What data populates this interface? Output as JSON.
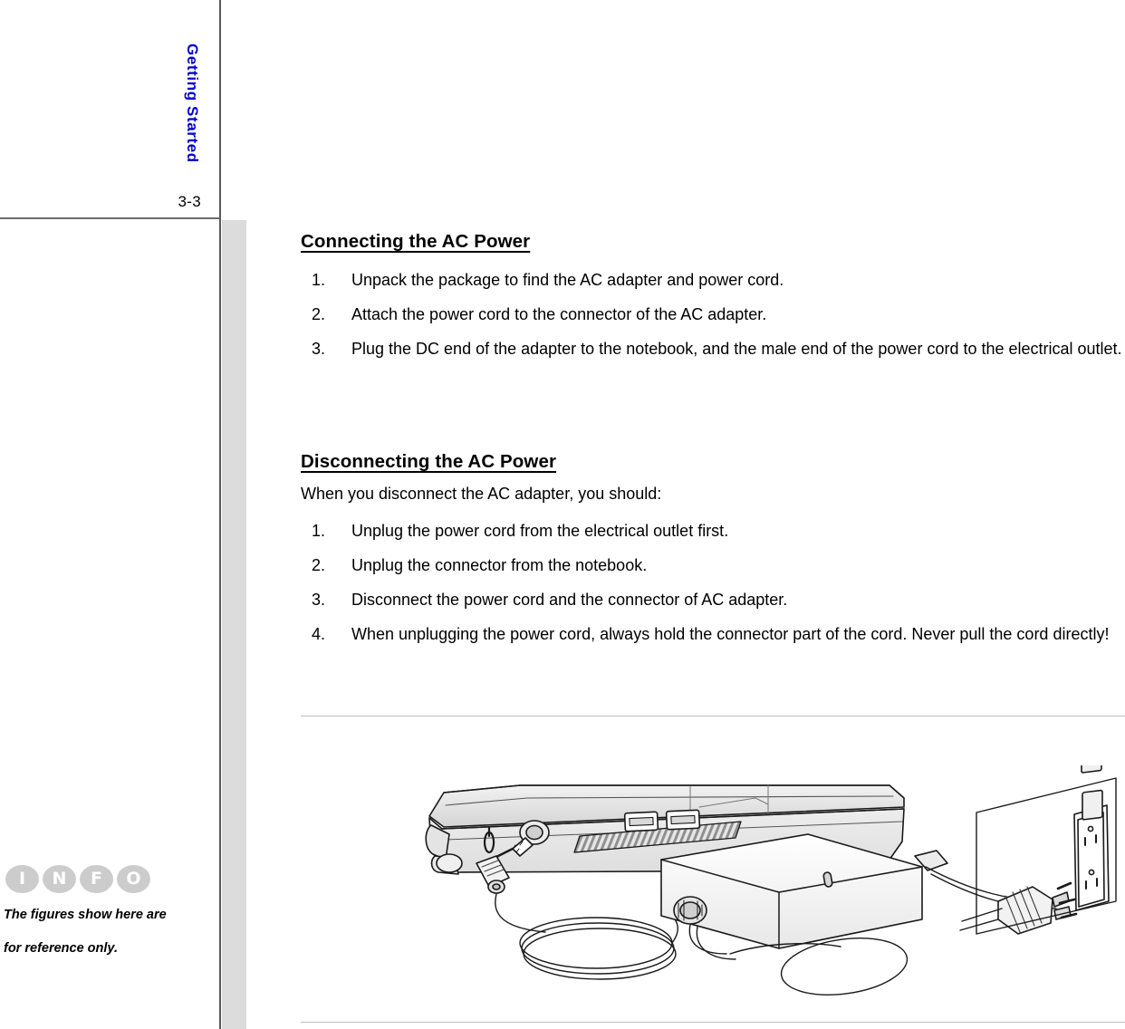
{
  "page": {
    "number": "3-3",
    "chapter_label": "Getting Started"
  },
  "sections": [
    {
      "heading": "Connecting the AC Power",
      "steps": [
        "Unpack the package to find the AC adapter and power cord.",
        "Attach the power cord to the connector of the AC adapter.",
        "Plug the DC end of the adapter to the notebook, and the male end of the power cord to the electrical outlet."
      ]
    },
    {
      "heading": "Disconnecting the AC Power",
      "intro": "When you disconnect the AC adapter, you should:",
      "steps": [
        "Unplug the power cord from the electrical outlet first.",
        "Unplug the connector from the notebook.",
        "Disconnect the power cord and the connector of AC adapter.",
        "When unplugging the power cord, always hold the connector part of the cord. Never pull the cord directly!"
      ]
    }
  ],
  "numbers": {
    "one": "1.",
    "two": "2.",
    "three": "3.",
    "four": "4."
  },
  "info_note": {
    "badges": [
      "I",
      "N",
      "F",
      "O"
    ],
    "line1": "The figures show here are",
    "line2": "for reference only."
  },
  "illustration": {
    "caption": "notebook-ac-adapter-wall-outlet-diagram"
  },
  "colors": {
    "chapter_label": "#0000d2",
    "gray_band": "#dcdcdc",
    "rule": "#bfbfbf",
    "badge": "#cccccc"
  }
}
